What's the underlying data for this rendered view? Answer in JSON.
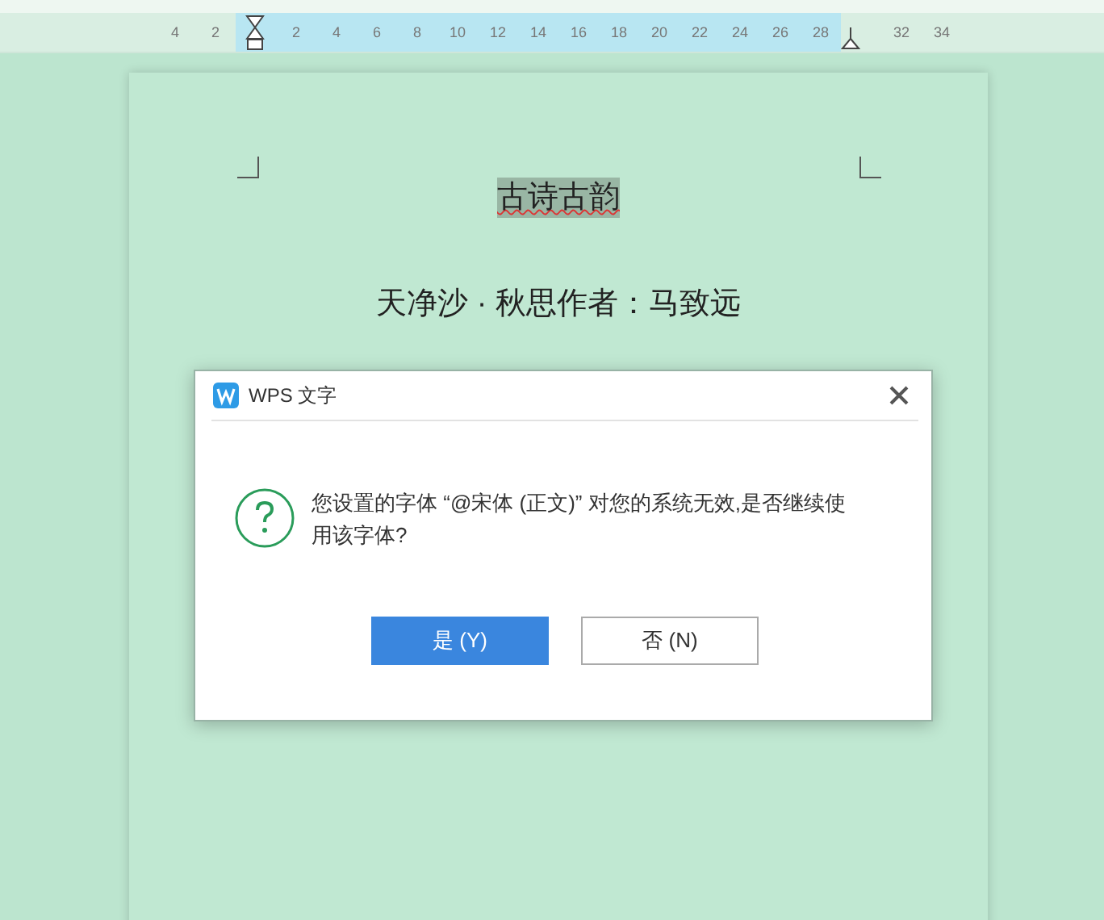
{
  "ruler": {
    "left_numbers": [
      "4",
      "2"
    ],
    "body_numbers": [
      "2",
      "4",
      "6",
      "8",
      "10",
      "12",
      "14",
      "16",
      "18",
      "20",
      "22",
      "24",
      "26",
      "28"
    ],
    "right_numbers": [
      "32",
      "34"
    ]
  },
  "document": {
    "title": "古诗古韵",
    "title_selected": true,
    "lines": [
      "天净沙 · 秋思作者：马致远"
    ]
  },
  "dialog": {
    "title": "WPS 文字",
    "message": "您设置的字体 “@宋体 (正文)” 对您的系统无效,是否继续使用该字体?",
    "buttons": [
      {
        "label": "是 (Y)",
        "primary": true
      },
      {
        "label": "否 (N)",
        "primary": false
      }
    ]
  }
}
